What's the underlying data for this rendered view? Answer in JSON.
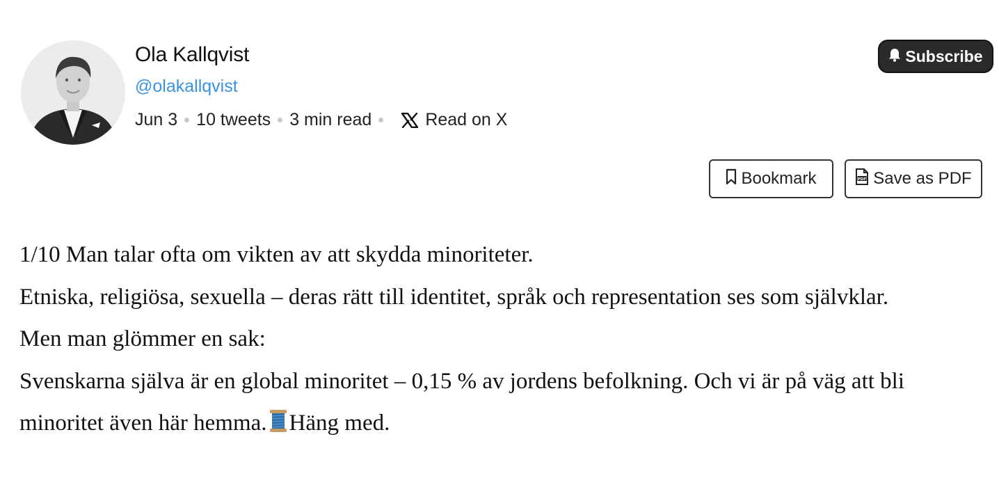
{
  "author": {
    "name": "Ola Kallqvist",
    "handle": "@olakallqvist"
  },
  "meta": {
    "date": "Jun 3",
    "tweet_count": "10 tweets",
    "read_time": "3 min read",
    "read_on_x": "Read on X"
  },
  "actions": {
    "subscribe_label": "Subscribe",
    "bookmark_label": "Bookmark",
    "save_pdf_label": "Save as PDF"
  },
  "tweet": {
    "line1": "1/10 Man talar ofta om vikten av att skydda minoriteter.",
    "line2": "Etniska, religiösa, sexuella – deras rätt till identitet, språk och representation ses som självklar.",
    "line3": "Men man glömmer en sak:",
    "line4_a": "Svenskarna själva är en global minoritet – 0,15 % av jordens befolkning. Och vi är på väg att bli minoritet även här hemma.",
    "line4_b": "Häng med."
  },
  "icons": {
    "avatar": "author-avatar",
    "x_logo": "x-logo-icon",
    "bell": "bell-icon",
    "bookmark": "bookmark-icon",
    "pdf": "pdf-file-icon",
    "spool": "spool-of-thread-emoji"
  },
  "colors": {
    "handle": "#3a93e0",
    "subscribe_bg": "#2b2b2b"
  }
}
